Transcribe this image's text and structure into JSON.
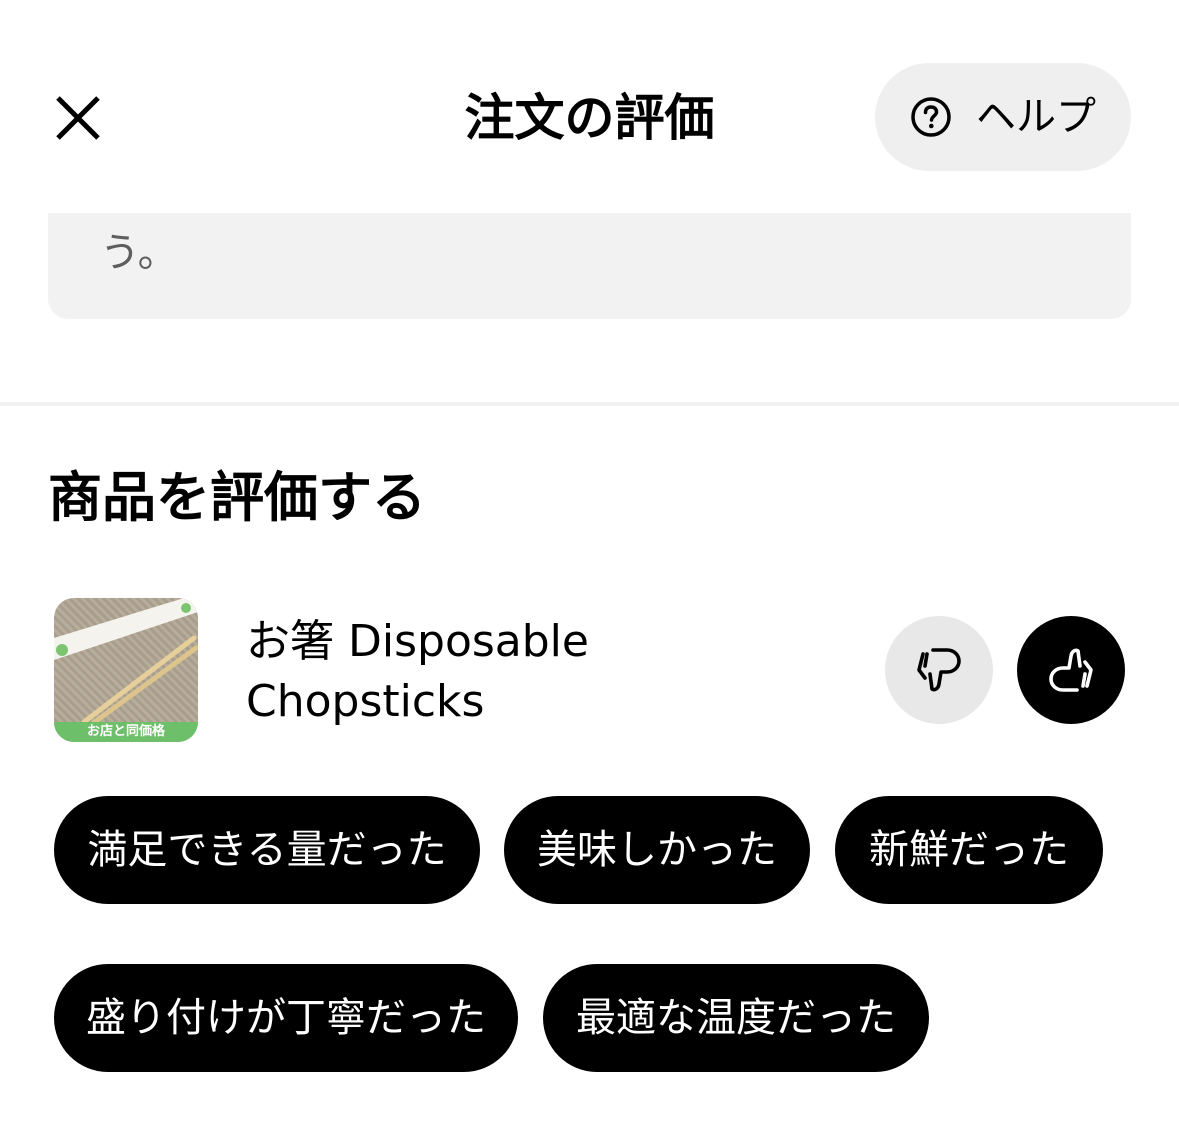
{
  "header": {
    "title": "注文の評価",
    "help_label": "ヘルプ",
    "close_icon": "close-icon",
    "help_icon": "question-circle-icon"
  },
  "comment": {
    "text": "う。"
  },
  "rate_items": {
    "section_title": "商品を評価する",
    "item": {
      "name": "お箸 Disposable Chopsticks",
      "thumbnail_label": "お店と同価格",
      "thumbs_down_icon": "thumbs-down-icon",
      "thumbs_up_icon": "thumbs-up-icon",
      "selected_rating": "thumbs-up"
    },
    "tags": [
      "満足できる量だった",
      "美味しかった",
      "新鮮だった",
      "盛り付けが丁寧だった",
      "最適な温度だった"
    ]
  },
  "colors": {
    "background": "#ffffff",
    "chip_background": "#000000",
    "chip_text": "#ffffff",
    "help_background": "#efefef",
    "comment_background": "#f2f2f2"
  }
}
